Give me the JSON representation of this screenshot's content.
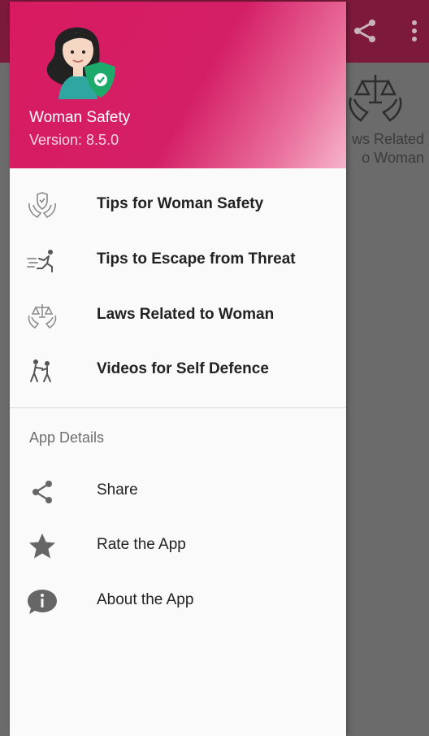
{
  "background": {
    "card_label": "ws Related\no Woman",
    "toolbar_color": "#7d1a3c"
  },
  "header": {
    "app_name": "Woman Safety",
    "version": "Version: 8.5.0",
    "gradient_start": "#d81b60",
    "gradient_end": "#f6b4cc"
  },
  "menu": {
    "items": [
      {
        "label": "Tips for Woman Safety",
        "icon": "safety-shield-hands-icon"
      },
      {
        "label": "Tips to Escape from Threat",
        "icon": "running-person-icon"
      },
      {
        "label": "Laws Related to Woman",
        "icon": "scales-hands-icon"
      },
      {
        "label": "Videos for Self Defence",
        "icon": "self-defence-icon"
      }
    ]
  },
  "details": {
    "title": "App Details",
    "items": [
      {
        "label": "Share",
        "icon": "share-icon"
      },
      {
        "label": "Rate the App",
        "icon": "star-icon"
      },
      {
        "label": "About the App",
        "icon": "info-icon"
      }
    ]
  }
}
